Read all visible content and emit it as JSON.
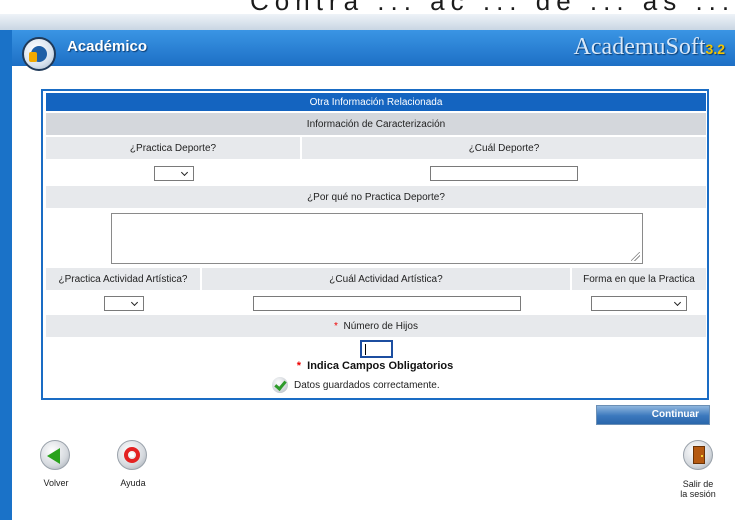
{
  "header": {
    "top_strip_text": "Contra ... ac ... de ... as ... de",
    "app_title": "Académico",
    "brand": "AcademuSoft",
    "brand_version": "3.2"
  },
  "form": {
    "section_title": "Otra Información Relacionada",
    "subsection_title": "Información de Caracterización",
    "practica_deporte_label": "¿Practica Deporte?",
    "cual_deporte_label": "¿Cuál Deporte?",
    "por_que_no_label": "¿Por qué no Practica Deporte?",
    "practica_arte_label": "¿Practica Actividad Artística?",
    "cual_arte_label": "¿Cuál Actividad Artística?",
    "forma_practica_label": "Forma en que la Practica",
    "hijos_label": "Número de Hijos",
    "required_mark": "*",
    "obligatorios_label": "Indica Campos Obligatorios",
    "success_message": "Datos guardados correctamente.",
    "practica_deporte_value": "",
    "cual_deporte_value": "",
    "por_que_no_value": "",
    "practica_arte_value": "",
    "cual_arte_value": "",
    "forma_practica_value": "",
    "hijos_value": ""
  },
  "actions": {
    "continuar_label": "Continuar"
  },
  "nav": {
    "volver_label": "Volver",
    "ayuda_label": "Ayuda",
    "salir_label_line1": "Salir de",
    "salir_label_line2": "la sesión"
  },
  "colors": {
    "header_blue": "#1d6fc5",
    "section_blue": "#1464c0",
    "required_red": "#e00000",
    "success_green": "#2e9b2b"
  }
}
